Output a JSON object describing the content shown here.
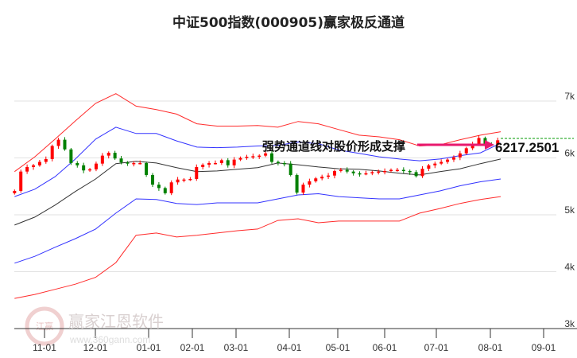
{
  "chart_data": {
    "type": "line",
    "title": "中证500指数(000905)赢家极反通道",
    "y_ticks": [
      {
        "value": 3000,
        "label": "3k"
      },
      {
        "value": 4000,
        "label": "4k"
      },
      {
        "value": 5000,
        "label": "5k"
      },
      {
        "value": 6000,
        "label": "6k"
      },
      {
        "value": 7000,
        "label": "7k"
      }
    ],
    "ylim": [
      3000,
      7000
    ],
    "x_ticks": [
      "11-01",
      "12-01",
      "01-01",
      "02-01",
      "03-01",
      "04-01",
      "05-01",
      "06-01",
      "07-01",
      "08-01",
      "09-01"
    ],
    "x_range_months": [
      -0.6,
      9.08
    ],
    "grid": true,
    "candles_close": [
      5420,
      5760,
      5840,
      5870,
      5930,
      5980,
      6210,
      6320,
      6150,
      5910,
      5870,
      5780,
      5800,
      5900,
      6040,
      6090,
      5990,
      5920,
      5900,
      5910,
      5910,
      5700,
      5530,
      5470,
      5380,
      5570,
      5620,
      5620,
      5630,
      5840,
      5880,
      5910,
      5910,
      5960,
      5870,
      5970,
      6000,
      6020,
      6030,
      6040,
      6080,
      5930,
      5910,
      5900,
      5700,
      5390,
      5530,
      5590,
      5640,
      5670,
      5690,
      5770,
      5790,
      5760,
      5730,
      5720,
      5730,
      5750,
      5760,
      5770,
      5790,
      5790,
      5770,
      5750,
      5680,
      5810,
      5870,
      5900,
      5930,
      5970,
      6010,
      6080,
      6170,
      6250,
      6350,
      6240,
      6230,
      6310
    ],
    "series": [
      {
        "name": "upper-red",
        "color": "#ff2a2a",
        "values": [
          5760,
          6020,
          6330,
          6650,
          6960,
          7130,
          6910,
          6850,
          6770,
          6600,
          6560,
          6560,
          6570,
          6540,
          6640,
          6600,
          6500,
          6400,
          6370,
          6320,
          6210,
          6230,
          6320,
          6400,
          6460
        ]
      },
      {
        "name": "upper-blue",
        "color": "#3333ff",
        "values": [
          5320,
          5450,
          5670,
          5980,
          6330,
          6540,
          6430,
          6430,
          6300,
          6190,
          6180,
          6190,
          6210,
          6220,
          6280,
          6250,
          6140,
          6080,
          6020,
          5980,
          5950,
          5980,
          6040,
          6090,
          6260
        ]
      },
      {
        "name": "middle-black",
        "color": "#333333",
        "values": [
          4820,
          4960,
          5170,
          5410,
          5630,
          5900,
          5940,
          5910,
          5830,
          5760,
          5770,
          5800,
          5830,
          5910,
          5880,
          5840,
          5810,
          5800,
          5770,
          5730,
          5700,
          5760,
          5810,
          5900,
          5980
        ]
      },
      {
        "name": "lower-blue",
        "color": "#3333ff",
        "values": [
          4150,
          4270,
          4430,
          4580,
          4750,
          5030,
          5280,
          5270,
          5200,
          5180,
          5210,
          5210,
          5210,
          5280,
          5350,
          5370,
          5320,
          5300,
          5280,
          5280,
          5350,
          5420,
          5510,
          5580,
          5630
        ]
      },
      {
        "name": "lower-red",
        "color": "#ff2a2a",
        "values": [
          3530,
          3600,
          3690,
          3780,
          3900,
          4160,
          4640,
          4680,
          4610,
          4640,
          4680,
          4720,
          4750,
          4900,
          4930,
          4860,
          4890,
          4890,
          4890,
          4890,
          5030,
          5110,
          5200,
          5270,
          5320
        ]
      }
    ],
    "band_x_range_months": [
      -0.6,
      9.14
    ],
    "annotation": "强势通道线对股价形成支撑",
    "last_price_label": "6217.2501",
    "last_price": 6217.2501,
    "colors": {
      "up": "#ff0000",
      "down": "#008000",
      "arrow": "#e8196e",
      "last_line": "#009900"
    }
  },
  "watermark": {
    "name": "赢家江恩软件",
    "url": "www.360gann.com",
    "logo": "江赢恩家"
  }
}
